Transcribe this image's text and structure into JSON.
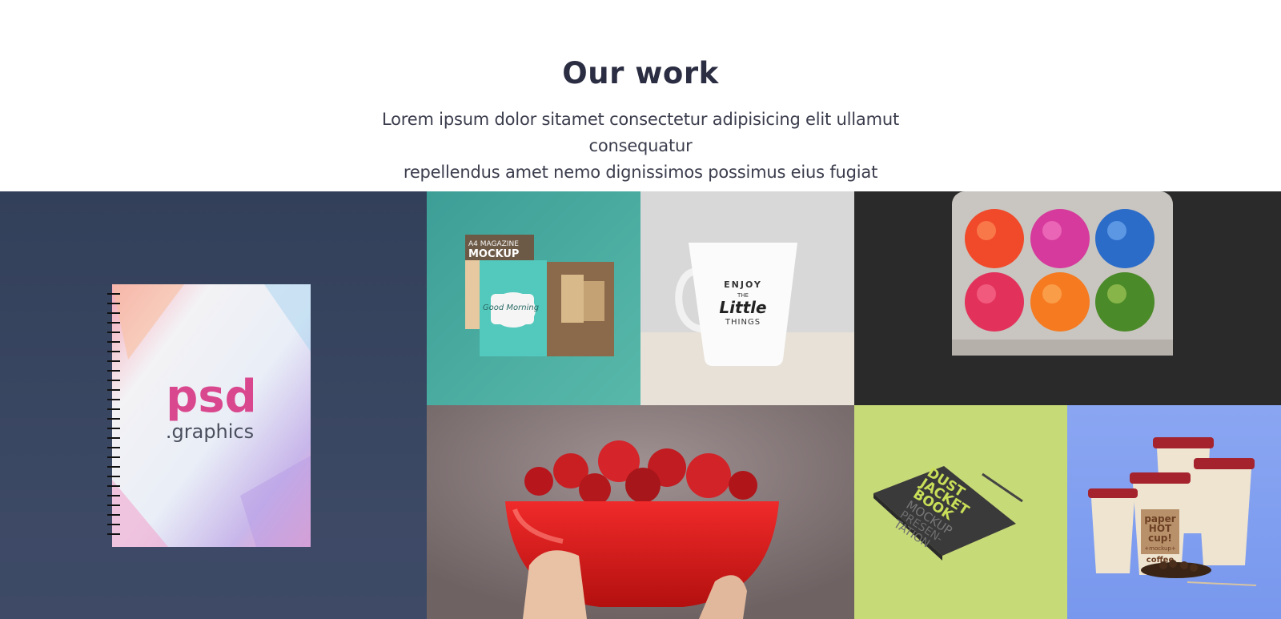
{
  "section": {
    "title": "Our work",
    "subtitle_line1": "Lorem ipsum dolor sitamet consectetur adipisicing elit ullamut consequatur",
    "subtitle_line2": "repellendus amet nemo dignissimos possimus eius fugiat"
  },
  "portfolio": {
    "notebook": {
      "brand": "psd",
      "brand_sub": ".graphics"
    },
    "magazine": {
      "label_small": "A4 MAGAZINE",
      "label_big": "MOCKUP",
      "cup_text": "Good Morning"
    },
    "mug": {
      "line1": "ENJOY",
      "line2": "THE",
      "line3": "Little",
      "line4": "THINGS"
    },
    "book": {
      "line1": "DUST",
      "line2": "JACKET",
      "line3": "BOOK",
      "line4": "MOCKUP",
      "line5": "PRESEN-",
      "line6": "TATION"
    },
    "cups": {
      "line1": "paper",
      "line2": "HOT",
      "line3": "cup!",
      "line4": "+mockup+",
      "line5": "coffee"
    }
  },
  "colors": {
    "title": "#2b2d42",
    "text": "#3b3d4d",
    "notebook_bg": "#3a4660",
    "magazine_bg": "#45aaa0",
    "mug_bg": "#d6d6d6",
    "eggs_bg": "#2b2b2b",
    "strawberry_bg": "#8d7f80",
    "book_bg": "#c9dc7a",
    "cups_bg": "#8ea8f0"
  }
}
